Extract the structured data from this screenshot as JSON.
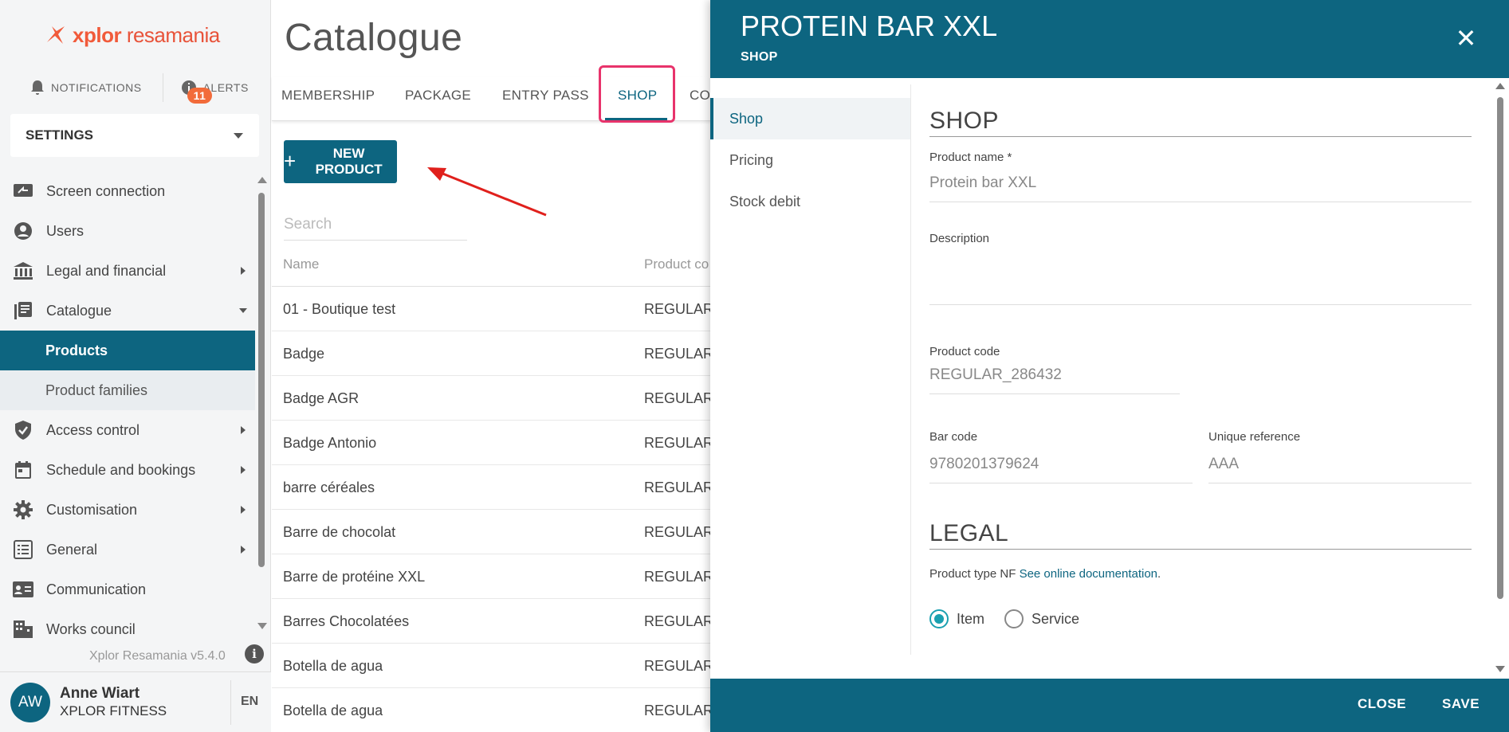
{
  "brand": {
    "name_bold": "xplor",
    "name_light": "resamania",
    "accent": "#f15a3a"
  },
  "header": {
    "notifications_label": "NOTIFICATIONS",
    "alerts_label": "ALERTS",
    "alerts_count": "11"
  },
  "settings_select": {
    "value": "SETTINGS"
  },
  "sidebar": {
    "items": [
      {
        "label": "Screen connection",
        "icon": "screen-connection-icon"
      },
      {
        "label": "Users",
        "icon": "user-circle-icon"
      },
      {
        "label": "Legal and financial",
        "icon": "bank-icon"
      },
      {
        "label": "Catalogue",
        "icon": "catalogue-icon"
      },
      {
        "label": "Products"
      },
      {
        "label": "Product families"
      },
      {
        "label": "Access control",
        "icon": "shield-icon"
      },
      {
        "label": "Schedule and bookings",
        "icon": "calendar-icon"
      },
      {
        "label": "Customisation",
        "icon": "gear-icon"
      },
      {
        "label": "General",
        "icon": "list-icon"
      },
      {
        "label": "Communication",
        "icon": "contact-card-icon"
      },
      {
        "label": "Works council",
        "icon": "building-icon"
      }
    ],
    "version": "Xplor Resamania v5.4.0"
  },
  "user": {
    "initials": "AW",
    "name": "Anne Wiart",
    "org": "XPLOR FITNESS",
    "lang": "EN"
  },
  "main": {
    "title": "Catalogue",
    "tabs": [
      "MEMBERSHIP",
      "PACKAGE",
      "ENTRY PASS",
      "SHOP",
      "CO"
    ],
    "new_product_label": "NEW PRODUCT",
    "search_placeholder": "Search",
    "columns": [
      "Name",
      "Product co"
    ],
    "rows": [
      {
        "name": "01 - Boutique test",
        "code": "REGULAR_"
      },
      {
        "name": "Badge",
        "code": "REGULAR_"
      },
      {
        "name": "Badge AGR",
        "code": "REGULAR_"
      },
      {
        "name": "Badge Antonio",
        "code": "REGULAR_"
      },
      {
        "name": "barre céréales",
        "code": "REGULAR_"
      },
      {
        "name": "Barre de chocolat",
        "code": "REGULAR_"
      },
      {
        "name": "Barre de protéine XXL",
        "code": "REGULAR_"
      },
      {
        "name": "Barres Chocolatées",
        "code": "REGULAR_"
      },
      {
        "name": "Botella de agua",
        "code": "REGULAR_"
      },
      {
        "name": "Botella de agua",
        "code": "REGULAR_"
      }
    ]
  },
  "panel": {
    "title": "PROTEIN BAR XXL",
    "subtitle": "SHOP",
    "nav": [
      "Shop",
      "Pricing",
      "Stock debit"
    ],
    "shop_section": "SHOP",
    "product_name_label": "Product name *",
    "product_name_value": "Protein bar XXL",
    "description_label": "Description",
    "product_code_label": "Product code",
    "product_code_value": "REGULAR_286432",
    "bar_code_label": "Bar code",
    "bar_code_value": "9780201379624",
    "unique_ref_label": "Unique reference",
    "unique_ref_value": "AAA",
    "legal_section": "LEGAL",
    "product_type_label": "Product type NF",
    "doc_link": "See online documentation",
    "radio_item": "Item",
    "radio_service": "Service",
    "close_label": "CLOSE",
    "save_label": "SAVE"
  },
  "colors": {
    "primary": "#0d6580",
    "highlight": "#e8336b",
    "radio": "#1aa0b0"
  }
}
